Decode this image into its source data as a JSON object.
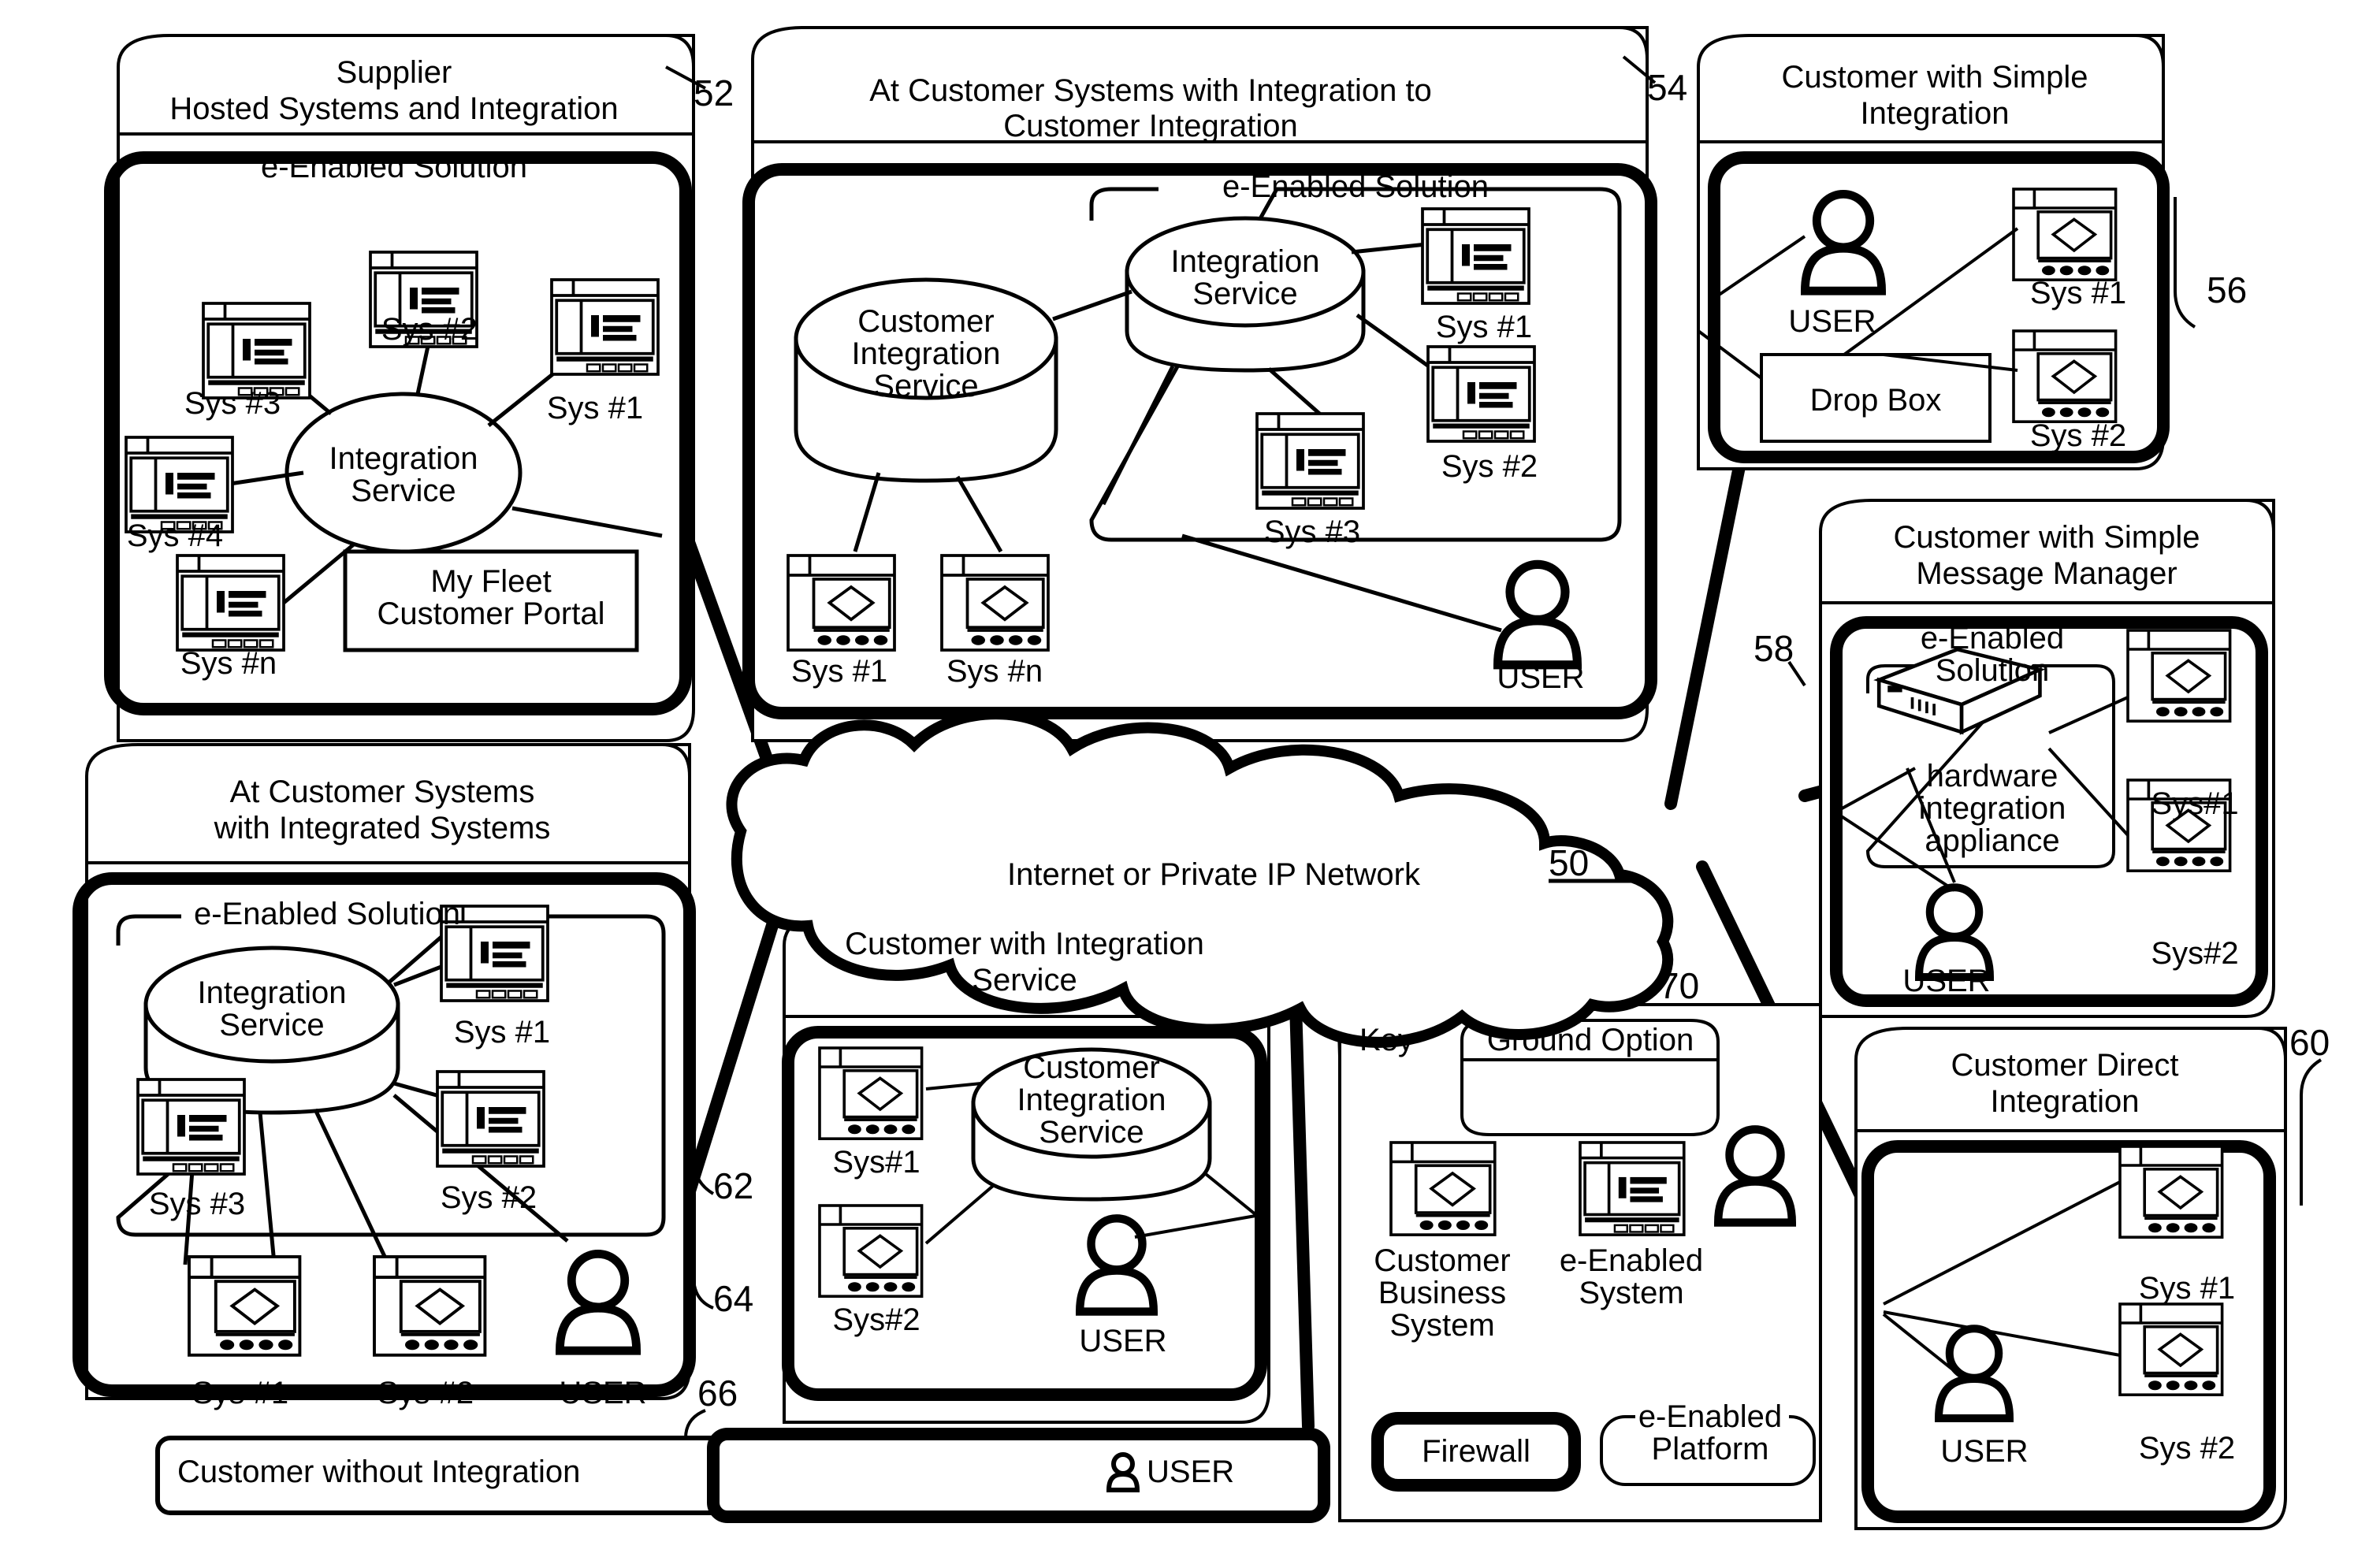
{
  "figure": {
    "network_cloud": {
      "label": "Internet or Private IP Network",
      "ref": "50"
    },
    "refs": {
      "supplier": "52",
      "at_customer_int": "54",
      "simple_integration": "56",
      "message_manager": "58",
      "direct_integration": "60",
      "customer_integration_service_panel": "62",
      "integrated_systems_panel": "64",
      "without_integration": "66",
      "key": "70"
    }
  },
  "panels": {
    "supplier": {
      "title_line1": "Supplier",
      "title_line2": "Hosted Systems and Integration",
      "ref": "52",
      "solution_title": "e-Enabled Solution",
      "hub": "Integration\nService",
      "portal": "My Fleet\nCustomer Portal",
      "systems": [
        "Sys #2",
        "Sys #1",
        "Sys #3",
        "Sys #4",
        "Sys #n"
      ]
    },
    "at_customer_integration": {
      "title_line1": "At Customer Systems with Integration to",
      "title_line2": "Customer Integration",
      "ref": "54",
      "customer_service": "Customer\nIntegration\nService",
      "solution_title": "e-Enabled Solution",
      "hub": "Integration\nService",
      "inner_systems": [
        "Sys #1",
        "Sys #2",
        "Sys #3"
      ],
      "outer_systems": [
        "Sys #1",
        "Sys #n"
      ],
      "user": "USER"
    },
    "simple_integration": {
      "title_line1": "Customer with Simple",
      "title_line2": "Integration",
      "ref": "56",
      "user": "USER",
      "dropbox": "Drop Box",
      "systems": [
        "Sys #1",
        "Sys #2"
      ]
    },
    "message_manager": {
      "title_line1": "Customer with Simple",
      "title_line2": "Message Manager",
      "ref": "58",
      "solution_title": "e-Enabled\nSolution",
      "appliance": "hardware\nintegration\nappliance",
      "user": "USER",
      "systems": [
        "Sys#1",
        "Sys#2"
      ]
    },
    "integrated_systems": {
      "title_line1": "At Customer Systems",
      "title_line2": "with Integrated Systems",
      "ref_service": "62",
      "ref_panel": "64",
      "solution_title": "e-Enabled Solution",
      "hub": "Integration\nService",
      "systems_top": [
        "Sys #1",
        "Sys #2",
        "Sys #3"
      ],
      "systems_bottom": [
        "Sys #1",
        "Sys #2"
      ],
      "user": "USER"
    },
    "customer_integration_service": {
      "title_line1": "Customer with Integration",
      "title_line2": "Service",
      "hub": "Customer\nIntegration\nService",
      "systems": [
        "Sys#1",
        "Sys#2"
      ],
      "user": "USER"
    },
    "direct_integration": {
      "title_line1": "Customer Direct",
      "title_line2": "Integration",
      "ref": "60",
      "user": "USER",
      "systems": [
        "Sys #1",
        "Sys #2"
      ]
    },
    "without_integration": {
      "label": "Customer without Integration",
      "ref": "66",
      "user": "USER"
    },
    "key": {
      "title": "Key",
      "ref": "70",
      "ground_option": "Ground Option",
      "customer_business_system": "Customer\nBusiness\nSystem",
      "e_enabled_system": "e-Enabled\nSystem",
      "firewall": "Firewall",
      "e_enabled_platform": "e-Enabled\nPlatform"
    }
  },
  "colors": {
    "ink": "#000000",
    "paper": "#ffffff"
  }
}
